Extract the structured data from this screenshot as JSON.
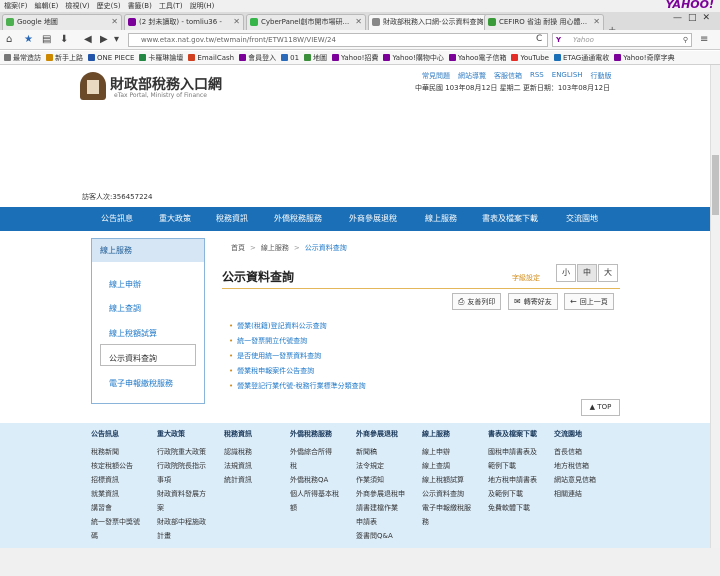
{
  "menubar": {
    "items": [
      "檔案(F)",
      "編輯(E)",
      "檢視(V)",
      "歷史(S)",
      "書籤(B)",
      "工具(T)",
      "說明(H)"
    ],
    "brand": "YAHOO!"
  },
  "tabs": [
    {
      "label": "Google 地圖",
      "color": "#4caf50"
    },
    {
      "label": "(2 封未讀取) - tomliu36 -",
      "color": "#7b0099"
    },
    {
      "label": "CyberPanel創市開市場研...",
      "color": "#38b54a"
    },
    {
      "label": "財政部稅務入口網-公示資料查詢",
      "color": "#888888"
    },
    {
      "label": "CEFIRO 省油 耐操 用心體...",
      "color": "#3a9a3a"
    }
  ],
  "nav": {
    "url": "www.etax.nat.gov.tw/etwmain/front/ETW118W/VIEW/24",
    "search_placeholder": "Yahoo",
    "search_engine": "Y"
  },
  "bookmarks": [
    {
      "label": "最常造訪",
      "color": "#777777"
    },
    {
      "label": "新手上路",
      "color": "#cc8800"
    },
    {
      "label": "ONE PIECE",
      "color": "#2255aa"
    },
    {
      "label": "卡羅琳論壇",
      "color": "#228844"
    },
    {
      "label": "EmailCash",
      "color": "#d04020"
    },
    {
      "label": "會員登入",
      "color": "#7b0099"
    },
    {
      "label": "01",
      "color": "#2a6ab8"
    },
    {
      "label": "地圖",
      "color": "#3b8f3b"
    },
    {
      "label": "Yahoo!招費",
      "color": "#7b0099"
    },
    {
      "label": "Yahoo!購物中心",
      "color": "#7b0099"
    },
    {
      "label": "Yahoo電子信箱",
      "color": "#7b0099"
    },
    {
      "label": "YouTube",
      "color": "#e52d27"
    },
    {
      "label": "ETAG通通電收",
      "color": "#1b6fb6"
    },
    {
      "label": "Yahoo!奇摩字典",
      "color": "#7b0099"
    }
  ],
  "header": {
    "logo_title": "財政部稅務入口網",
    "logo_subtitle": "eTax Portal, Ministry of Finance",
    "top_links": [
      "常見問題",
      "網站導覽",
      "客服信箱",
      "RSS",
      "ENGLISH",
      "行動版"
    ],
    "date_line": "中華民國 103年08月12日 星期二 更新日期：103年08月12日",
    "visits": "訪客人次:356457224"
  },
  "main_nav": [
    "公告訊息",
    "重大政策",
    "稅務資訊",
    "外僑稅務服務",
    "外商參展退稅",
    "線上服務",
    "書表及檔案下載",
    "交流園地"
  ],
  "sidebar": {
    "title": "線上服務",
    "items": [
      "線上申辦",
      "線上查調",
      "線上稅額試算",
      "公示資料查詢",
      "電子申報繳稅服務"
    ],
    "active_index": 3
  },
  "content": {
    "breadcrumb": [
      "首頁",
      "線上服務",
      "公示資料查詢"
    ],
    "title": "公示資料查詢",
    "font_size_label": "字級設定",
    "font_sizes": [
      "小",
      "中",
      "大"
    ],
    "selected_font_size": "中",
    "actions": [
      {
        "label": "友善列印",
        "icon": "print-icon"
      },
      {
        "label": "轉寄好友",
        "icon": "mail-icon"
      },
      {
        "label": "回上一頁",
        "icon": "back-arrow-icon"
      }
    ],
    "links": [
      "營業(稅籍)登記資料公示查詢",
      "統一發票開立代號查詢",
      "是否使用統一發票資料查詢",
      "營業稅申報案件公告查詢",
      "營業登記行業代號-稅務行業標準分類查詢"
    ],
    "top_button": "TOP"
  },
  "footer": [
    {
      "title": "公告訊息",
      "links": [
        "稅務新聞",
        "核定稅額公告",
        "招標資訊",
        "就業資訊",
        "講習會",
        "統一發票中獎號",
        "碼"
      ]
    },
    {
      "title": "重大政策",
      "links": [
        "行政院重大政策",
        "行政院院長指示",
        "事項",
        "財政資料發展方",
        "案",
        "財政部中程施政",
        "計畫"
      ]
    },
    {
      "title": "稅務資訊",
      "links": [
        "認識稅務",
        "法規資訊",
        "統計資訊"
      ]
    },
    {
      "title": "外僑稅務服務",
      "links": [
        "外僑綜合所得",
        "稅",
        "外僑稅務QA",
        "個人所得基本稅",
        "額"
      ]
    },
    {
      "title": "外商參展退稅",
      "links": [
        "新聞稿",
        "法令規定",
        "作業須知",
        "外商參展退稅申",
        "請書建檔作業",
        "申請表",
        "簽書問Q&A"
      ]
    },
    {
      "title": "線上服務",
      "links": [
        "線上申辦",
        "線上查調",
        "線上稅額試算",
        "公示資料查詢",
        "電子申報繳稅服",
        "務"
      ]
    },
    {
      "title": "書表及檔案下載",
      "links": [
        "國稅申請書表及",
        "範例下載",
        "地方稅申請書表",
        "及範例下載",
        "免費軟體下載"
      ]
    },
    {
      "title": "交流園地",
      "links": [
        "首長信箱",
        "地方稅信箱",
        "網站意見信箱",
        "相關連結"
      ]
    }
  ]
}
